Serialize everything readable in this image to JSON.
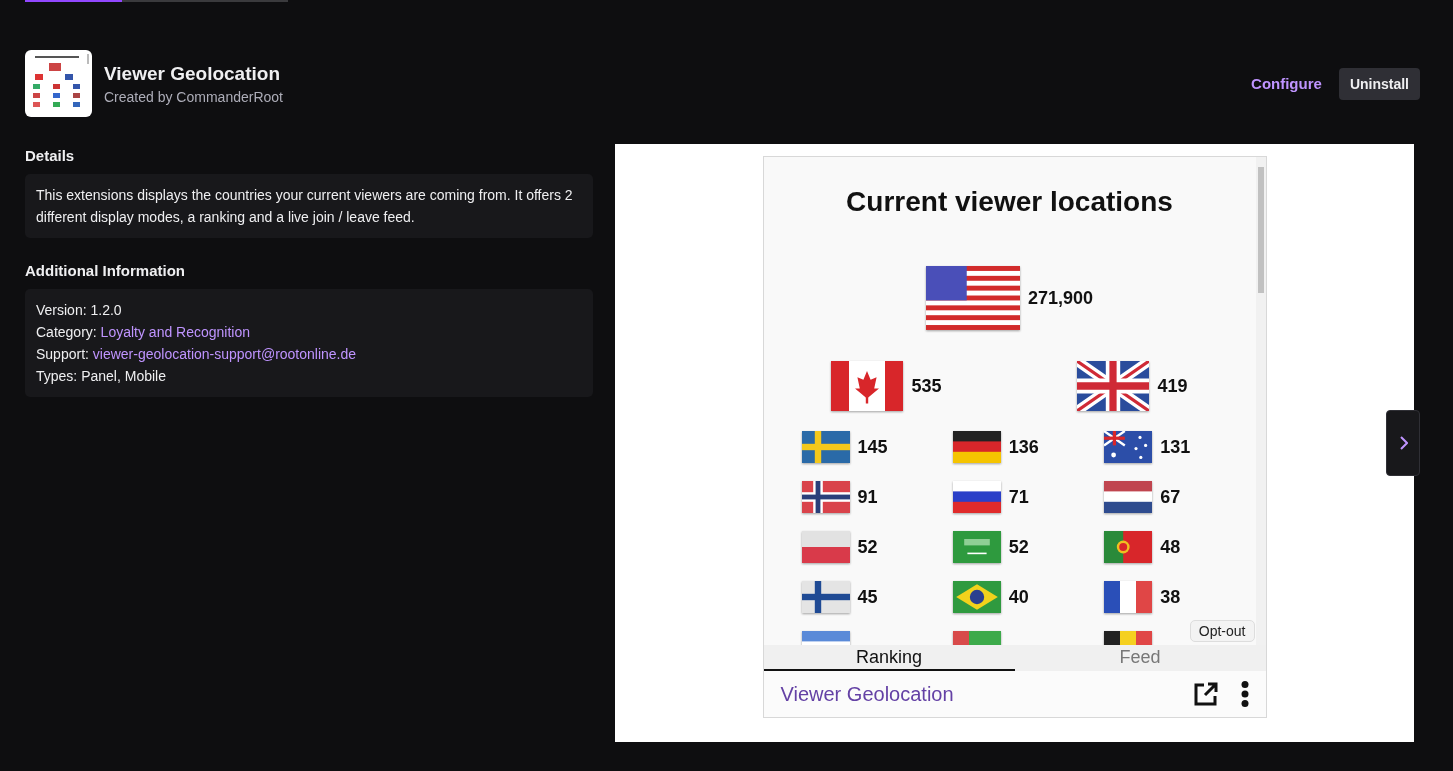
{
  "progress": {
    "level": 0.37
  },
  "extension": {
    "name": "Viewer Geolocation",
    "author": "Created by CommanderRoot"
  },
  "actions": [
    {
      "label": "Configure",
      "kind": "link"
    },
    {
      "label": "Uninstall",
      "kind": "button"
    }
  ],
  "details": {
    "heading": "Details",
    "text": "This extensions displays the countries your current viewers are coming from. It offers 2 different display modes, a ranking and a live join / leave feed."
  },
  "additional_information": {
    "heading": "Additional Information",
    "lines": [
      {
        "label": "Version:",
        "value": "1.2.0",
        "kind": "text"
      },
      {
        "label": "Category:",
        "value": "Loyalty and Recognition",
        "kind": "link"
      },
      {
        "label": "Support:",
        "value": "viewer-geolocation-support@rootonline.de",
        "kind": "link"
      },
      {
        "label": "Types:",
        "value": "Panel, Mobile",
        "kind": "text"
      }
    ]
  },
  "screenshot": {
    "title": "Current viewer locations",
    "ranking_rows": [
      [
        {
          "kind": "us",
          "count": "271,900"
        }
      ],
      [
        {
          "kind": "ca",
          "count": "535"
        },
        {
          "kind": "gb",
          "count": "419"
        }
      ],
      [
        {
          "kind": "se",
          "count": "145"
        },
        {
          "kind": "de",
          "count": "136"
        },
        {
          "kind": "au",
          "count": "131"
        }
      ],
      [
        {
          "kind": "no",
          "count": "91"
        },
        {
          "kind": "ru",
          "count": "71"
        },
        {
          "kind": "nl",
          "count": "67"
        }
      ],
      [
        {
          "kind": "pl",
          "count": "52"
        },
        {
          "kind": "sa",
          "count": "52"
        },
        {
          "kind": "pt",
          "count": "48"
        }
      ],
      [
        {
          "kind": "fi",
          "count": "45"
        },
        {
          "kind": "br",
          "count": "40"
        },
        {
          "kind": "fr",
          "count": "38"
        }
      ],
      [
        {
          "kind": "ar"
        },
        {
          "kind": "redgreen"
        },
        {
          "kind": "be"
        }
      ]
    ],
    "opt_out": "Opt-out",
    "tabs": [
      {
        "label": "Ranking",
        "selected": true
      },
      {
        "label": "Feed",
        "selected": false
      }
    ],
    "footer_title": "Viewer Geolocation"
  }
}
